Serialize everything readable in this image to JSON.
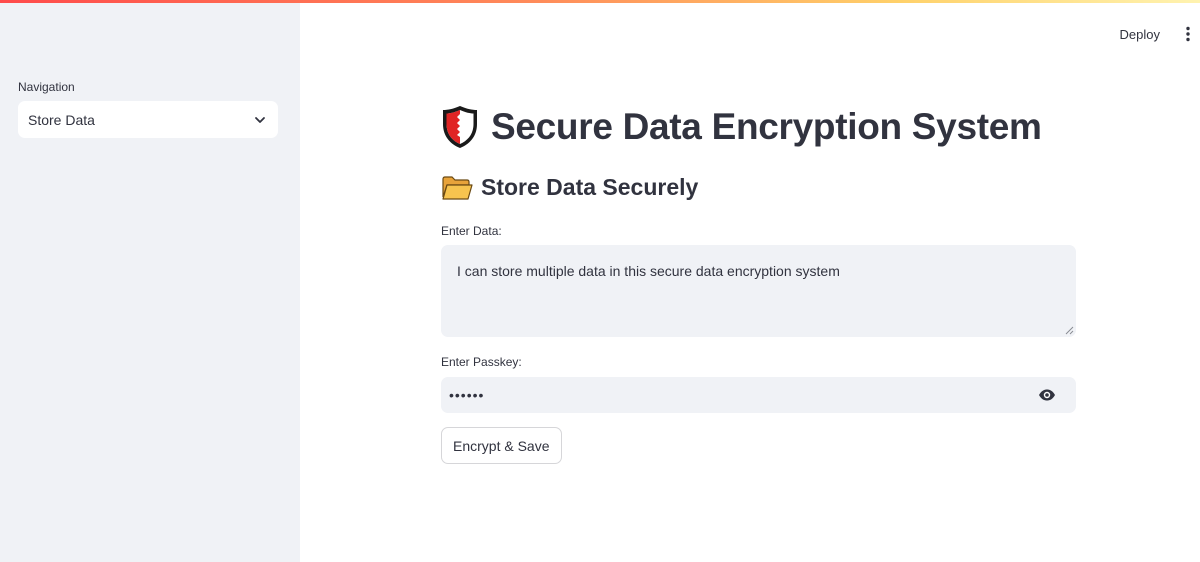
{
  "header": {
    "deploy_label": "Deploy",
    "menu_icon": "vertical-ellipsis-icon",
    "accent_gradient": [
      "#ff4b4b",
      "#ffd16a"
    ]
  },
  "sidebar": {
    "nav_label": "Navigation",
    "select_value": "Store Data",
    "select_icon": "chevron-down-icon",
    "background": "#f0f2f6"
  },
  "main": {
    "title": "Secure Data Encryption System",
    "title_icon": "shield-icon",
    "subtitle": "Store Data Securely",
    "subtitle_icon": "open-folder-icon",
    "data_label": "Enter Data:",
    "data_value": "I can store multiple data in this secure data encryption system",
    "passkey_label": "Enter Passkey:",
    "passkey_value": "••••••",
    "passkey_icon": "eye-icon",
    "button_label": "Encrypt & Save"
  }
}
